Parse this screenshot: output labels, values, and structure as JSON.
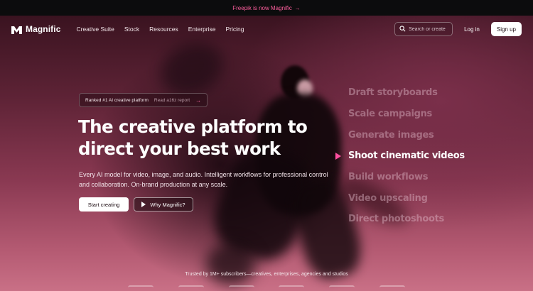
{
  "announcement": {
    "text": "Freepik is now Magnific",
    "arrow": "→"
  },
  "nav": {
    "brand": "Magnific",
    "links": [
      "Creative Suite",
      "Stock",
      "Resources",
      "Enterprise",
      "Pricing"
    ],
    "search_placeholder": "Search or create",
    "login": "Log in",
    "signup": "Sign up"
  },
  "hero": {
    "badge": {
      "text": "Ranked #1 AI creative platform",
      "link": "Read a16z report",
      "arrow": "→"
    },
    "headline_line1": "The creative platform to",
    "headline_line2": "direct your best work",
    "subtext": "Every AI model for video, image, and audio. Intelligent workflows for professional control and collaboration. On-brand production at any scale.",
    "cta_primary": "Start creating",
    "cta_secondary": "Why Magnific?"
  },
  "features": {
    "active_index": 3,
    "items": [
      "Draft storyboards",
      "Scale campaigns",
      "Generate images",
      "Shoot cinematic videos",
      "Build workflows",
      "Video upscaling",
      "Direct photoshoots"
    ]
  },
  "trusted": "Trusted by 1M+ subscribers—creatives, enterprises, agencies and studios",
  "colors": {
    "accent": "#ff4fa0",
    "announcement_text": "#ff5f9e",
    "background": "#5e2336"
  },
  "icons": {
    "logo": "magnific-logo-icon",
    "search": "search-icon",
    "play": "play-icon",
    "arrow": "arrow-right-icon",
    "pointer": "pointer-triangle-icon"
  }
}
